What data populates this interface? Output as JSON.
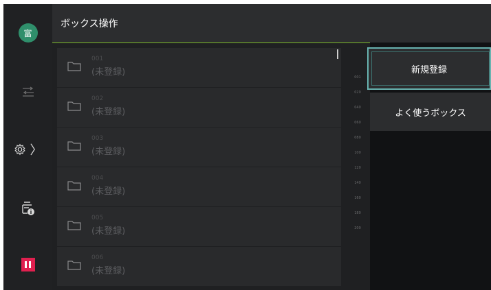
{
  "header": {
    "title": "ボックス操作"
  },
  "rail": {
    "avatar_text": "富",
    "items": [
      {
        "icon": "avatar"
      },
      {
        "icon": "transfer-icon"
      },
      {
        "icon": "gear-icon",
        "chevron": "〉"
      },
      {
        "icon": "printer-info-icon"
      },
      {
        "icon": "pause-icon"
      }
    ]
  },
  "boxes": [
    {
      "number": "001",
      "label": "(未登録)"
    },
    {
      "number": "002",
      "label": "(未登録)"
    },
    {
      "number": "003",
      "label": "(未登録)"
    },
    {
      "number": "004",
      "label": "(未登録)"
    },
    {
      "number": "005",
      "label": "(未登録)"
    },
    {
      "number": "006",
      "label": "(未登録)"
    }
  ],
  "jump_index": [
    "001",
    "020",
    "040",
    "060",
    "080",
    "100",
    "120",
    "140",
    "160",
    "180",
    "200"
  ],
  "actions": {
    "new_registration": "新規登録",
    "frequent_boxes": "よく使うボックス"
  },
  "colors": {
    "accent_line": "#7fbf2a",
    "focus_border": "#68b3b0",
    "pause": "#e0204f",
    "avatar": "#2f8f6b"
  }
}
